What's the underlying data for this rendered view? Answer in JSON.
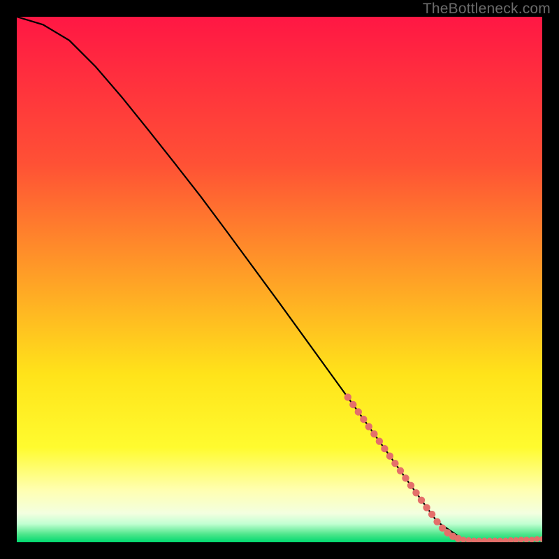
{
  "watermark": "TheBottleneck.com",
  "chart_data": {
    "type": "line",
    "title": "",
    "xlabel": "",
    "ylabel": "",
    "xlim": [
      0,
      100
    ],
    "ylim": [
      0,
      100
    ],
    "curve": {
      "x": [
        0,
        5,
        10,
        15,
        20,
        25,
        30,
        35,
        40,
        45,
        50,
        55,
        60,
        65,
        70,
        75,
        80,
        85,
        90,
        95,
        100
      ],
      "y": [
        100,
        98.5,
        95.5,
        90.5,
        84.7,
        78.5,
        72.2,
        65.8,
        59.1,
        52.3,
        45.5,
        38.6,
        31.7,
        24.8,
        17.8,
        10.8,
        3.9,
        0.5,
        0.3,
        0.4,
        0.6
      ]
    },
    "points_segment": {
      "x": [
        63,
        64,
        65,
        66,
        67,
        68,
        69,
        70,
        71,
        72,
        73,
        74,
        75,
        76,
        77,
        78,
        79,
        80,
        81,
        82,
        83,
        84
      ],
      "y": [
        27.6,
        26.2,
        24.8,
        23.4,
        22.0,
        20.6,
        19.2,
        17.8,
        16.4,
        15.0,
        13.6,
        12.2,
        10.8,
        9.4,
        8.0,
        6.6,
        5.3,
        3.9,
        2.7,
        1.8,
        1.1,
        0.7
      ]
    },
    "points_flat": {
      "x": [
        84,
        85,
        86,
        87,
        88,
        89,
        90,
        91,
        92,
        93,
        94,
        95,
        96,
        97,
        98,
        99,
        100
      ],
      "y": [
        0.7,
        0.5,
        0.4,
        0.3,
        0.3,
        0.3,
        0.3,
        0.3,
        0.3,
        0.3,
        0.4,
        0.4,
        0.5,
        0.5,
        0.5,
        0.6,
        0.6
      ]
    },
    "gradient_stops": [
      {
        "offset": 0,
        "color": "#ff1744"
      },
      {
        "offset": 0.28,
        "color": "#ff5135"
      },
      {
        "offset": 0.5,
        "color": "#ffa126"
      },
      {
        "offset": 0.68,
        "color": "#ffe31a"
      },
      {
        "offset": 0.82,
        "color": "#fffb2f"
      },
      {
        "offset": 0.9,
        "color": "#ffffb0"
      },
      {
        "offset": 0.945,
        "color": "#f3ffe0"
      },
      {
        "offset": 0.965,
        "color": "#c2ffd2"
      },
      {
        "offset": 0.985,
        "color": "#4de68b"
      },
      {
        "offset": 1.0,
        "color": "#00d96f"
      }
    ],
    "point_color": "#e46f6a",
    "curve_color": "#000000"
  }
}
